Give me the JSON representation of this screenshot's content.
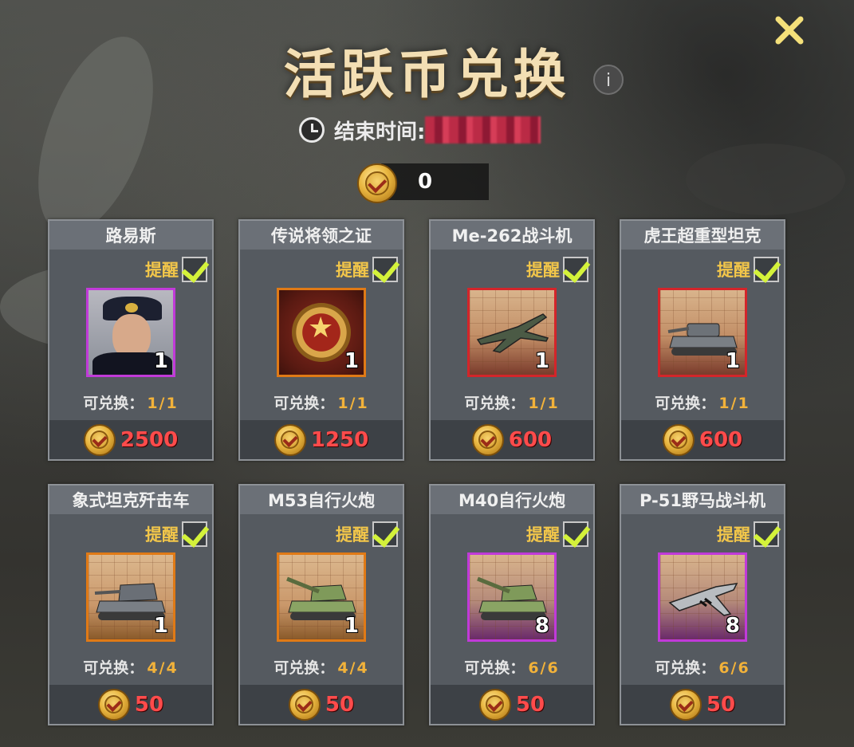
{
  "header": {
    "title": "活跃币兑换",
    "info_label": "i",
    "end_time_label": "结束时间:",
    "balance": "0"
  },
  "remind_label": "提醒",
  "exchangeable_label": "可兑换：",
  "colors": {
    "title": "#f3dfb4",
    "price": "#ff4b4b",
    "remind": "#f2c64a",
    "check": "#d4f23a",
    "purple_quality": "#c13ad9",
    "orange_quality": "#e07a16",
    "red_quality": "#d3252a"
  },
  "items": [
    {
      "name": "路易斯",
      "count": "1",
      "limit": "1/1",
      "price": "2500",
      "quality": "purple",
      "icon": "admiral-portrait-icon",
      "reminder_checked": true
    },
    {
      "name": "传说将领之证",
      "count": "1",
      "limit": "1/1",
      "price": "1250",
      "quality": "orange",
      "icon": "star-medal-icon",
      "reminder_checked": true
    },
    {
      "name": "Me-262战斗机",
      "count": "1",
      "limit": "1/1",
      "price": "600",
      "quality": "red",
      "icon": "jet-fighter-icon",
      "reminder_checked": true
    },
    {
      "name": "虎王超重型坦克",
      "count": "1",
      "limit": "1/1",
      "price": "600",
      "quality": "red",
      "icon": "heavy-tank-icon",
      "reminder_checked": true
    },
    {
      "name": "象式坦克歼击车",
      "count": "1",
      "limit": "4/4",
      "price": "50",
      "quality": "orange",
      "icon": "tank-destroyer-icon",
      "reminder_checked": true
    },
    {
      "name": "M53自行火炮",
      "count": "1",
      "limit": "4/4",
      "price": "50",
      "quality": "orange",
      "icon": "self-propelled-gun-icon",
      "reminder_checked": true
    },
    {
      "name": "M40自行火炮",
      "count": "8",
      "limit": "6/6",
      "price": "50",
      "quality": "purple",
      "icon": "self-propelled-gun-icon",
      "reminder_checked": true
    },
    {
      "name": "P-51野马战斗机",
      "count": "8",
      "limit": "6/6",
      "price": "50",
      "quality": "purple",
      "icon": "propeller-fighter-icon",
      "reminder_checked": true
    }
  ]
}
